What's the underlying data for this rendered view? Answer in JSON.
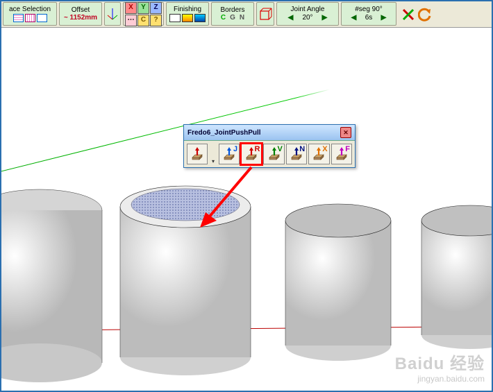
{
  "toolbar": {
    "face_selection": {
      "label": "ace Selection"
    },
    "offset": {
      "label": "Offset",
      "value": "~ 1152mm"
    },
    "axes": {
      "x": "X",
      "y": "Y",
      "z": "Z",
      "c": "C",
      "q": "?"
    },
    "finishing": {
      "label": "Finishing"
    },
    "borders": {
      "label": "Borders",
      "c": "C",
      "g": "G",
      "n": "N"
    },
    "joint_angle": {
      "label": "Joint Angle",
      "value": "20°"
    },
    "seg": {
      "label": "#seg 90°",
      "value": "6s"
    }
  },
  "palette": {
    "title": "Fredo6_JointPushPull",
    "buttons": [
      {
        "letter": "",
        "color": "#c00",
        "selected": false
      },
      {
        "letter": "J",
        "color": "#0055dd",
        "selected": false
      },
      {
        "letter": "R",
        "color": "#d00000",
        "selected": true
      },
      {
        "letter": "V",
        "color": "#008000",
        "selected": false
      },
      {
        "letter": "N",
        "color": "#001080",
        "selected": false
      },
      {
        "letter": "X",
        "color": "#e07000",
        "selected": false
      },
      {
        "letter": "F",
        "color": "#c000c0",
        "selected": false
      }
    ]
  },
  "watermark": {
    "brand": "Baidu 经验",
    "url": "jingyan.baidu.com"
  }
}
